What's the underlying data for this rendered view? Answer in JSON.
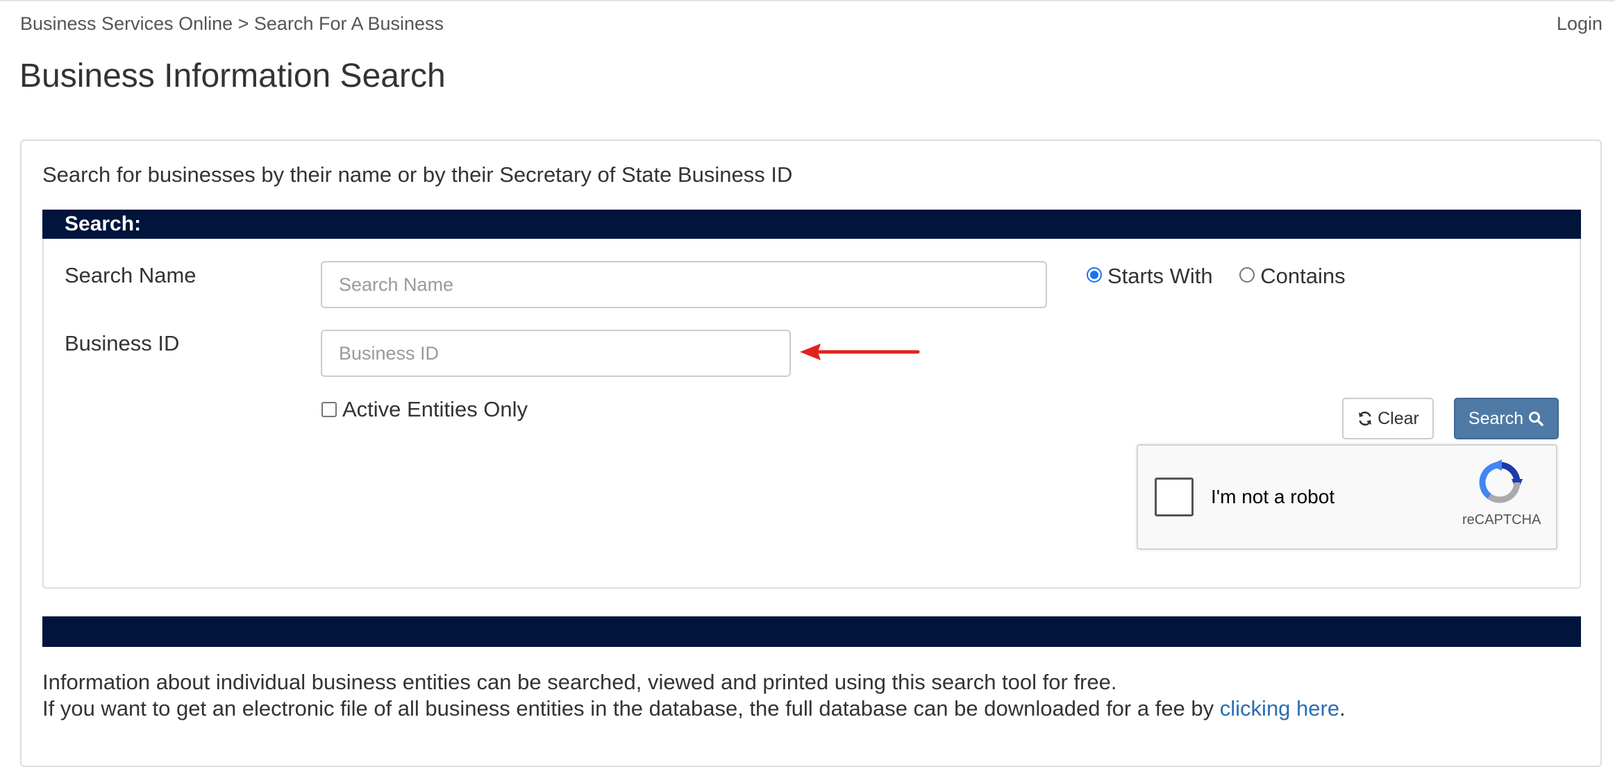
{
  "header": {
    "breadcrumb": "Business Services Online > Search For A Business",
    "login_label": "Login",
    "page_title": "Business Information Search"
  },
  "panel": {
    "intro_text": "Search for businesses by their name or by their Secretary of State Business ID",
    "search_heading": "Search:"
  },
  "form": {
    "search_name_label": "Search Name",
    "search_name_placeholder": "Search Name",
    "search_name_value": "",
    "business_id_label": "Business ID",
    "business_id_placeholder": "Business ID",
    "business_id_value": "",
    "radio_options": [
      {
        "label": "Starts With",
        "selected": true
      },
      {
        "label": "Contains",
        "selected": false
      }
    ],
    "active_only_label": "Active Entities Only",
    "active_only_checked": false,
    "clear_label": "Clear",
    "search_label": "Search"
  },
  "recaptcha": {
    "checkbox_label": "I'm not a robot",
    "brand": "reCAPTCHA"
  },
  "footer_info": {
    "line1": "Information about individual business entities can be searched, viewed and printed using this search tool for free.",
    "line2_prefix": "If you want to get an electronic file of all business entities in the database, the full database can be downloaded for a fee by ",
    "link_text": "clicking here",
    "line2_suffix": "."
  },
  "colors": {
    "header_bar": "#00143c",
    "search_button": "#4f7aa6",
    "link": "#2a6eb3",
    "annotation_arrow": "#e3221c"
  },
  "icons": {
    "clear": "refresh-icon",
    "search": "magnifier-icon",
    "annotation": "red-arrow-icon"
  }
}
